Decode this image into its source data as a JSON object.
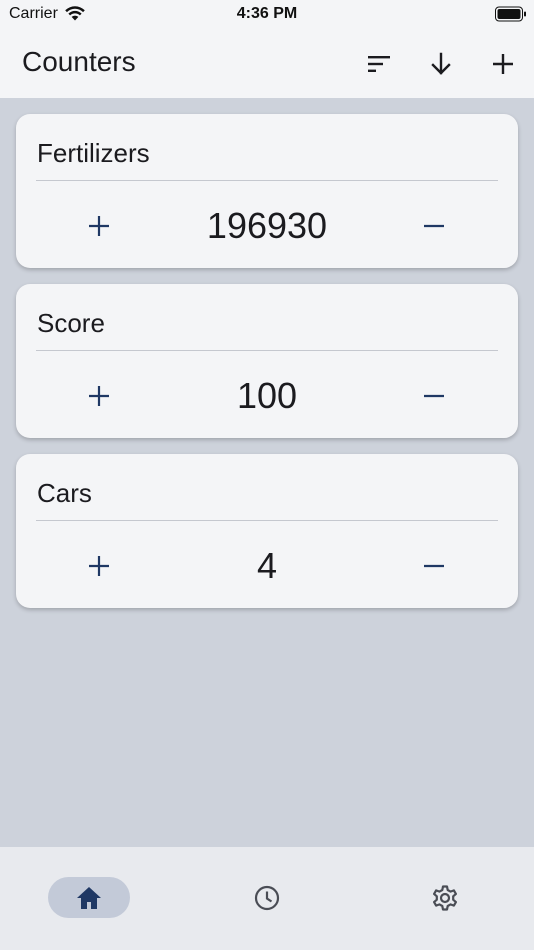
{
  "status_bar": {
    "carrier": "Carrier",
    "time": "4:36 PM",
    "icons": [
      "wifi-icon",
      "battery-icon"
    ]
  },
  "app_bar": {
    "title": "Counters",
    "actions": [
      "sort-icon",
      "arrow-down-icon",
      "plus-icon"
    ]
  },
  "counters": [
    {
      "name": "Fertilizers",
      "value": "196930"
    },
    {
      "name": "Score",
      "value": "100"
    },
    {
      "name": "Cars",
      "value": "4"
    }
  ],
  "counter_controls": {
    "increment_icon": "plus-icon",
    "decrement_icon": "minus-icon"
  },
  "bottom_nav": {
    "items": [
      {
        "icon": "home-icon",
        "selected": true
      },
      {
        "icon": "clock-icon",
        "selected": false
      },
      {
        "icon": "gear-icon",
        "selected": false
      }
    ]
  },
  "colors": {
    "background": "#cdd2db",
    "surface": "#f4f5f7",
    "accent": "#1f3864",
    "nav_selected": "#c3cad8"
  }
}
